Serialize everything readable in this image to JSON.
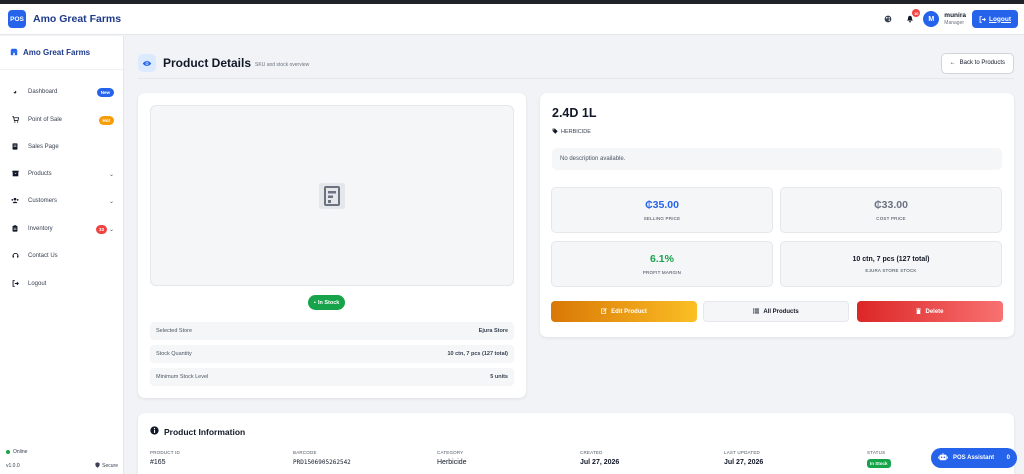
{
  "app": {
    "logo_text": "POS",
    "brand": "Amo Great Farms"
  },
  "navbar": {
    "notification_count": "10",
    "avatar_initial": "M",
    "user_name": "munira",
    "user_role": "Manager",
    "logout_label": "Logout"
  },
  "sidebar": {
    "header": "Amo Great Farms",
    "items": [
      {
        "label": "Dashboard",
        "icon": "gauge-icon",
        "badge": "New",
        "badge_color": "#2563eb"
      },
      {
        "label": "Point of Sale",
        "icon": "cart-icon",
        "badge": "Hot",
        "badge_color": "#f59e0b"
      },
      {
        "label": "Sales Page",
        "icon": "receipt-icon"
      },
      {
        "label": "Products",
        "icon": "box-icon",
        "has_submenu": true
      },
      {
        "label": "Customers",
        "icon": "users-icon",
        "has_submenu": true
      },
      {
        "label": "Inventory",
        "icon": "clipboard-icon",
        "badge": "33",
        "badge_color": "#ef4444",
        "has_submenu": true
      },
      {
        "label": "Contact Us",
        "icon": "headset-icon"
      },
      {
        "label": "Logout",
        "icon": "sign-out-icon"
      }
    ],
    "footer": {
      "status": "Online",
      "version": "v1.0.0",
      "secure": "Secure"
    }
  },
  "page": {
    "title": "Product Details",
    "subtitle": "SKU and stock overview",
    "back_label": "Back to Products"
  },
  "image_card": {
    "stock_status": "In Stock",
    "rows": [
      {
        "label": "Selected Store",
        "value": "Ejura Store"
      },
      {
        "label": "Stock Quantity",
        "value": "10 ctn, 7 pcs (127 total)"
      },
      {
        "label": "Minimum Stock Level",
        "value": "5 units"
      }
    ]
  },
  "product": {
    "name": "2.4D 1L",
    "category": "HERBICIDE",
    "description": "No description available.",
    "stats": [
      {
        "value": "₵35.00",
        "label": "SELLING PRICE",
        "color": "#2563eb"
      },
      {
        "value": "₵33.00",
        "label": "COST PRICE",
        "color": "#6b7280"
      },
      {
        "value": "6.1%",
        "label": "PROFIT MARGIN",
        "color": "#16a34a"
      },
      {
        "value": "10 ctn, 7 pcs (127 total)",
        "label": "EJURA STORE STOCK",
        "color": "#111827"
      }
    ],
    "actions": {
      "edit": "Edit Product",
      "all": "All Products",
      "delete": "Delete"
    }
  },
  "product_info": {
    "title": "Product Information",
    "columns": [
      {
        "label": "PRODUCT ID",
        "value": "#165"
      },
      {
        "label": "BARCODE",
        "value": "PRD1506905262542"
      },
      {
        "label": "CATEGORY",
        "value": "Herbicide"
      },
      {
        "label": "CREATED",
        "value": "Jul 27, 2026"
      },
      {
        "label": "LAST UPDATED",
        "value": "Jul 27, 2026"
      },
      {
        "label": "STATUS",
        "value": "In Stock"
      }
    ]
  },
  "assistant": {
    "label": "POS Assistant",
    "count": "0"
  }
}
